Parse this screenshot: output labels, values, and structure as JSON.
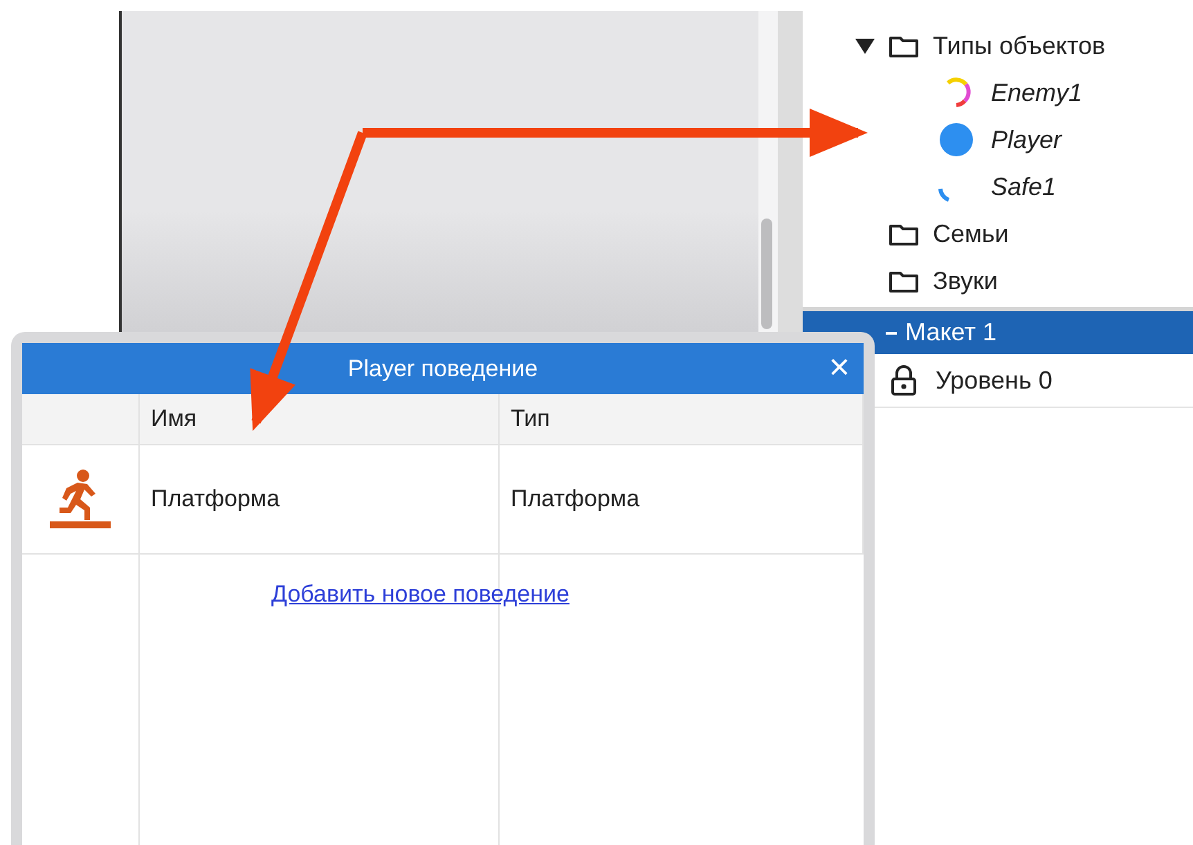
{
  "project_tree": [
    {
      "label": "Типы объектов",
      "kind": "folder",
      "expanded": true,
      "children": [
        {
          "label": "Enemy1",
          "kind": "ring"
        },
        {
          "label": "Player",
          "kind": "dot"
        },
        {
          "label": "Safe1",
          "kind": "arc"
        }
      ]
    },
    {
      "label": "Семьи",
      "kind": "folder",
      "expanded": false
    },
    {
      "label": "Звуки",
      "kind": "folder",
      "expanded": false
    }
  ],
  "layers": {
    "layout": {
      "label": "Макет 1",
      "expanded": true,
      "selected": true
    },
    "items": [
      {
        "label": "Уровень 0",
        "locked": true
      }
    ]
  },
  "dialog": {
    "title": "Player поведение",
    "close": "×",
    "columns": [
      "Имя",
      "Тип"
    ],
    "rows": [
      {
        "kind": "platform",
        "name": "Платформа",
        "type": "Платформа"
      }
    ],
    "add_link": "Добавить новое поведение"
  }
}
